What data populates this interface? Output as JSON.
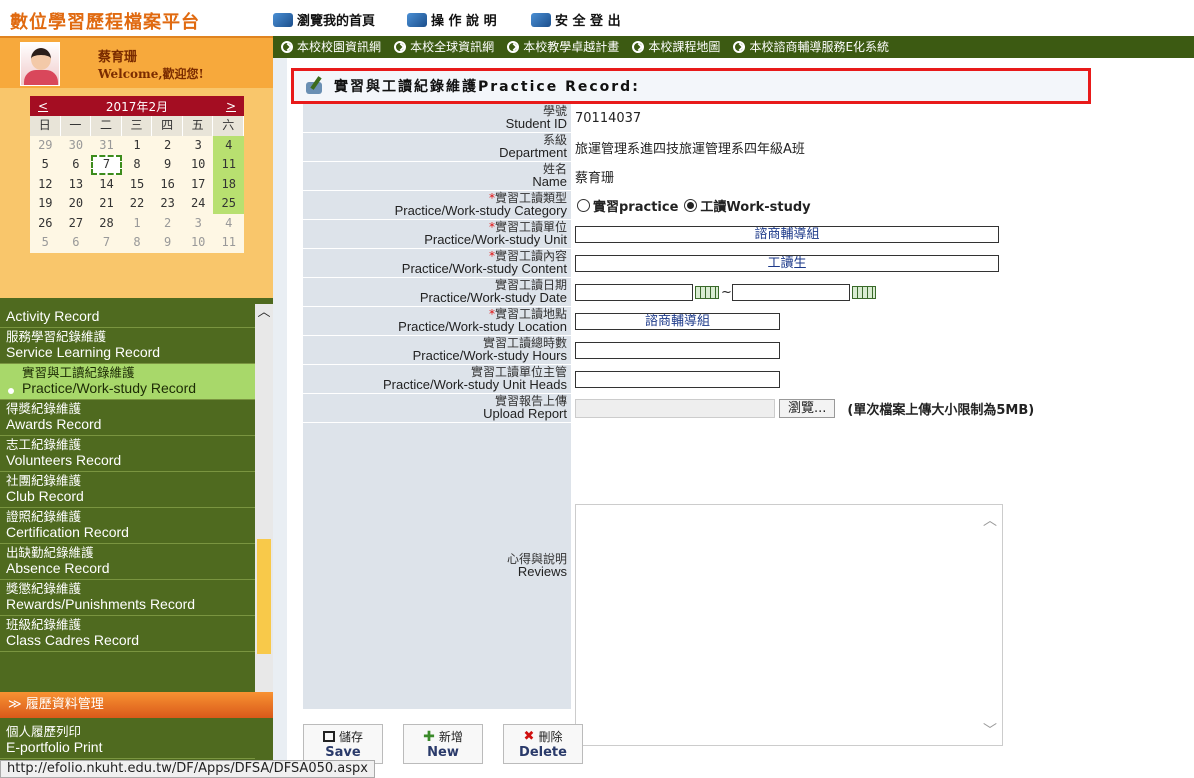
{
  "app": {
    "title": "數位學習歷程檔案平台"
  },
  "user": {
    "name": "蔡育珊",
    "welcome": "Welcome,歡迎您!"
  },
  "calendar": {
    "prev": "<",
    "next": ">",
    "month_label": "2017年2月",
    "weekdays": [
      "日",
      "一",
      "二",
      "三",
      "四",
      "五",
      "六"
    ],
    "weeks": [
      [
        "29",
        "30",
        "31",
        "1",
        "2",
        "3",
        "4"
      ],
      [
        "5",
        "6",
        "7",
        "8",
        "9",
        "10",
        "11"
      ],
      [
        "12",
        "13",
        "14",
        "15",
        "16",
        "17",
        "18"
      ],
      [
        "19",
        "20",
        "21",
        "22",
        "23",
        "24",
        "25"
      ],
      [
        "26",
        "27",
        "28",
        "1",
        "2",
        "3",
        "4"
      ],
      [
        "5",
        "6",
        "7",
        "8",
        "9",
        "10",
        "11"
      ]
    ]
  },
  "topnav": {
    "home": "瀏覽我的首頁",
    "help": "操 作 說 明",
    "logout": "安 全 登 出"
  },
  "news": [
    "本校校園資訊網",
    "本校全球資訊網",
    "本校教學卓越計畫",
    "本校課程地圖",
    "本校諮商輔導服務E化系統"
  ],
  "menu": {
    "items": [
      {
        "zh": "",
        "en": "Activity Record"
      },
      {
        "zh": "服務學習紀錄維護",
        "en": "Service Learning Record"
      },
      {
        "zh": "實習與工讀紀錄維護",
        "en": "Practice/Work-study Record"
      },
      {
        "zh": "得獎紀錄維護",
        "en": "Awards Record"
      },
      {
        "zh": "志工紀錄維護",
        "en": "Volunteers Record"
      },
      {
        "zh": "社團紀錄維護",
        "en": "Club Record"
      },
      {
        "zh": "證照紀錄維護",
        "en": "Certification Record"
      },
      {
        "zh": "出缺勤紀錄維護",
        "en": "Absence Record"
      },
      {
        "zh": "獎懲紀錄維護",
        "en": "Rewards/Punishments Record"
      },
      {
        "zh": "班級紀錄維護",
        "en": "Class Cadres Record"
      }
    ],
    "section": "履歷資料管理",
    "print_zh": "個人履歷列印",
    "print_en": "E-portfolio Print"
  },
  "form": {
    "title": "實習與工讀紀錄維護Practice Record:",
    "fields": {
      "student_id": {
        "zh": "學號",
        "en": "Student ID",
        "value": "70114037"
      },
      "department": {
        "zh": "系級",
        "en": "Department",
        "value": "旅運管理系進四技旅運管理系四年級A班"
      },
      "name": {
        "zh": "姓名",
        "en": "Name",
        "value": "蔡育珊"
      },
      "category": {
        "req": "*",
        "zh": "實習工讀類型",
        "en": "Practice/Work-study Category",
        "opt1": "實習practice",
        "opt2": "工讀Work-study",
        "selected": "工讀Work-study"
      },
      "unit": {
        "req": "*",
        "zh": "實習工讀單位",
        "en": "Practice/Work-study Unit",
        "value": "諮商輔導組"
      },
      "content": {
        "req": "*",
        "zh": "實習工讀內容",
        "en": "Practice/Work-study Content",
        "value": "工讀生"
      },
      "date": {
        "zh": "實習工讀日期",
        "en": "Practice/Work-study Date",
        "sep": "~",
        "start": "",
        "end": ""
      },
      "location": {
        "req": "*",
        "zh": "實習工讀地點",
        "en": "Practice/Work-study Location",
        "value": "諮商輔導組"
      },
      "hours": {
        "zh": "實習工讀總時數",
        "en": "Practice/Work-study Hours",
        "value": ""
      },
      "heads": {
        "zh": "實習工讀單位主管",
        "en": "Practice/Work-study Unit Heads",
        "value": ""
      },
      "upload": {
        "zh": "實習報告上傳",
        "en": "Upload Report",
        "browse": "瀏覽...",
        "note": "(單次檔案上傳大小限制為5MB)"
      },
      "reviews": {
        "zh": "心得與說明",
        "en": "Reviews",
        "value": ""
      }
    },
    "buttons": {
      "save_zh": "儲存",
      "save_en": "Save",
      "new_zh": "新增",
      "new_en": "New",
      "delete_zh": "刪除",
      "delete_en": "Delete"
    }
  },
  "status": {
    "url": "http://efolio.nkuht.edu.tw/DF/Apps/DFSA/DFSA050.aspx"
  }
}
